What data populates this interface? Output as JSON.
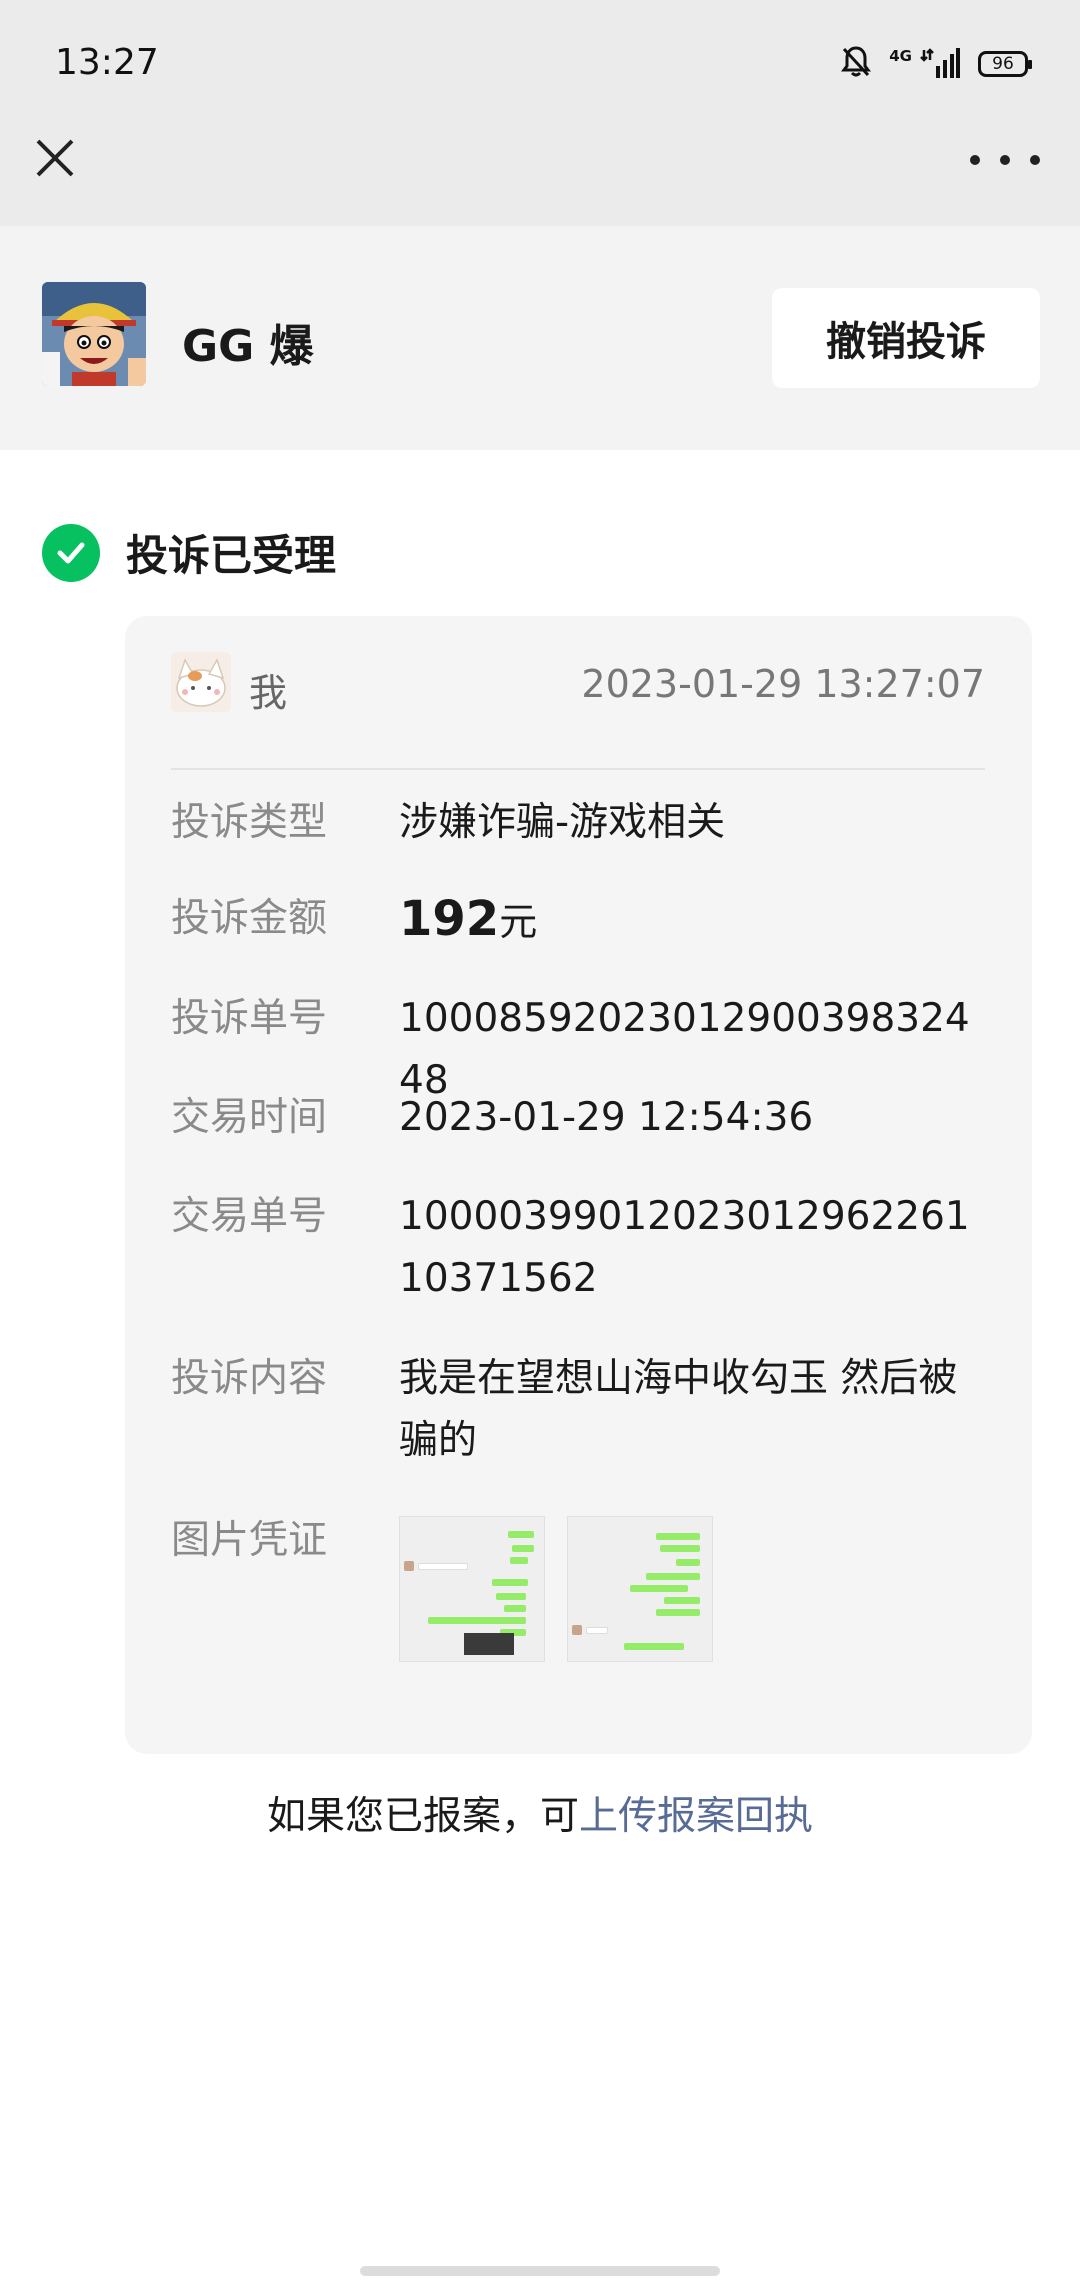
{
  "status_bar": {
    "time": "13:27",
    "network": "4G",
    "battery": "96",
    "icons": [
      "mute-bell-icon",
      "signal-icon",
      "battery-icon"
    ]
  },
  "nav": {
    "close_icon": "close-icon",
    "more_icon": "more-icon"
  },
  "merchant": {
    "name": "GG 爆",
    "revoke_label": "撤销投诉"
  },
  "status": {
    "title": "投诉已受理",
    "icon": "check-circle-icon",
    "color": "#07c160"
  },
  "card": {
    "user_label": "我",
    "timestamp": "2023-01-29 13:27:07",
    "rows": [
      {
        "label": "投诉类型",
        "value": "涉嫌诈骗-游戏相关"
      },
      {
        "label": "投诉金额",
        "amount": "192",
        "unit": "元"
      },
      {
        "label": "投诉单号",
        "value": "1000859202301290039832448"
      },
      {
        "label": "交易时间",
        "value": "2023-01-29 12:54:36"
      },
      {
        "label": "交易单号",
        "value": "1000039901202301296226110371562"
      },
      {
        "label": "投诉内容",
        "value": "我是在望想山海中收勾玉 然后被骗的"
      },
      {
        "label": "图片凭证",
        "images": [
          "chat-screenshot-1",
          "chat-screenshot-2"
        ]
      }
    ]
  },
  "footer": {
    "text": "如果您已报案，可",
    "link": "上传报案回执",
    "link_color": "#576b95"
  }
}
